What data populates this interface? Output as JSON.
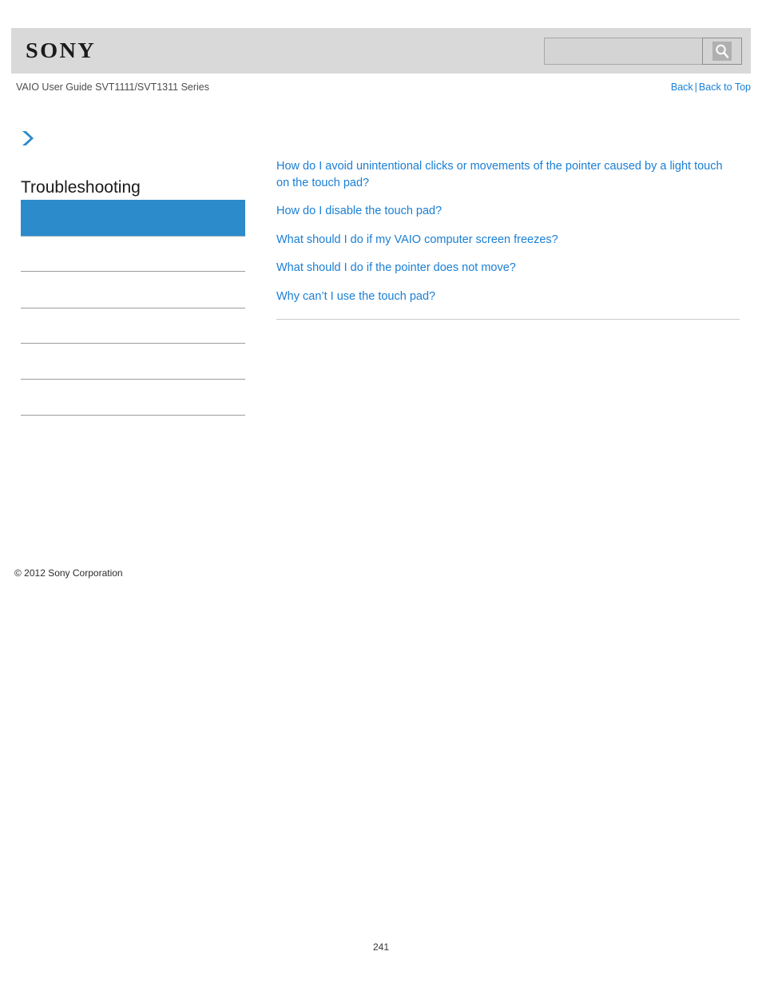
{
  "header": {
    "logo_text": "SONY",
    "search": {
      "value": "",
      "placeholder": "",
      "icon": "search-icon",
      "glyph": "⌕"
    }
  },
  "subheader": {
    "guide_title": "VAIO User Guide SVT1111/SVT1311 Series",
    "back_label": "Back",
    "separator": "|",
    "back_to_top_label": "Back to Top"
  },
  "sidebar": {
    "breadcrumb_icon": "chevron-right-icon",
    "heading": "Troubleshooting",
    "accent_color": "#2b8bcb",
    "items": [
      {
        "label": "",
        "active": true
      },
      {
        "label": "",
        "active": false
      },
      {
        "label": "",
        "active": false
      },
      {
        "label": "",
        "active": false
      },
      {
        "label": "",
        "active": false
      },
      {
        "label": "",
        "active": false
      }
    ],
    "copyright": "© 2012 Sony Corporation"
  },
  "main": {
    "links": [
      "How do I avoid unintentional clicks or movements of the pointer caused by a light touch on the touch pad?",
      "How do I disable the touch pad?",
      "What should I do if my VAIO computer screen freezes?",
      "What should I do if the pointer does not move?",
      "Why can’t I use the touch pad?"
    ],
    "link_color": "#1a7fd4"
  },
  "footer": {
    "page_number": "241"
  }
}
